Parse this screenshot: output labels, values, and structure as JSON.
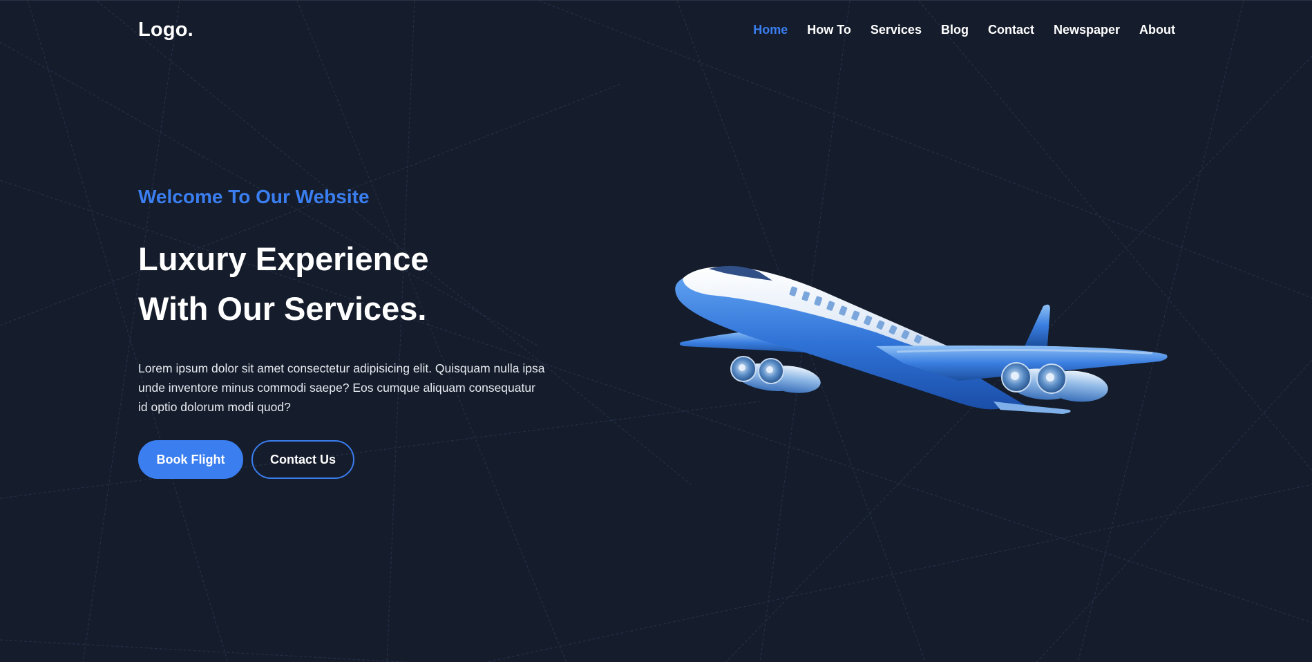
{
  "brand": {
    "logo_text": "Logo."
  },
  "nav": {
    "items": [
      {
        "label": "Home",
        "active": true
      },
      {
        "label": "How To",
        "active": false
      },
      {
        "label": "Services",
        "active": false
      },
      {
        "label": "Blog",
        "active": false
      },
      {
        "label": "Contact",
        "active": false
      },
      {
        "label": "Newspaper",
        "active": false
      },
      {
        "label": "About",
        "active": false
      }
    ]
  },
  "hero": {
    "welcome": "Welcome To Our Website",
    "headline_line1": "Luxury Experience",
    "headline_line2": "With Our Services.",
    "description": "Lorem ipsum dolor sit amet consectetur adipisicing elit. Quisquam nulla ipsa unde inventore minus commodi saepe? Eos cumque aliquam consequatur id optio dolorum modi quod?",
    "primary_button": "Book Flight",
    "secondary_button": "Contact Us"
  },
  "illustration": {
    "icon": "airplane-illustration"
  },
  "colors": {
    "background": "#151c2b",
    "accent": "#3a7ef0",
    "text": "#ffffff"
  }
}
